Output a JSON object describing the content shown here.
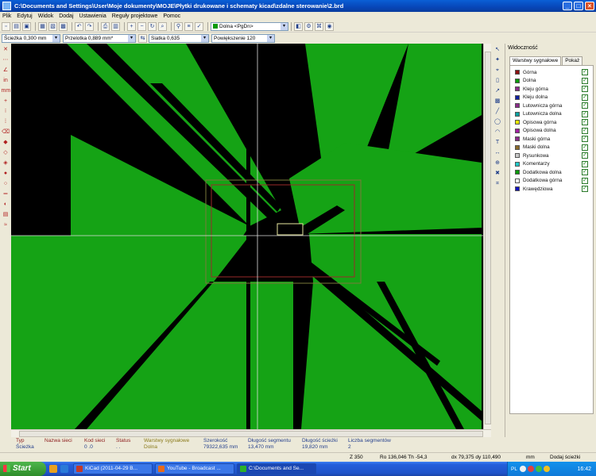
{
  "window": {
    "title": "C:\\Documents and Settings\\User\\Moje dokumenty\\MOJE\\Płytki drukowane i schematy kicad\\zdalne sterowanie\\2.brd",
    "minimize": "_",
    "maximize": "□",
    "close": "×"
  },
  "menu": [
    "Plik",
    "Edytuj",
    "Widok",
    "Dodaj",
    "Ustawienia",
    "Reguły projektowe",
    "Pomoc"
  ],
  "toolbar": {
    "active_layer": "Dolna <PgDn>"
  },
  "toolbar2": {
    "track": "Ścieżka 0,300 mm",
    "via": "Przelotka 0,889 mm*",
    "grid": "Siatka 0,635",
    "zoom": "Powiększenie 120"
  },
  "panel": {
    "title": "Widoczność",
    "tabs": [
      "Warstwy sygnałowe",
      "Pokaż"
    ],
    "layers": [
      {
        "name": "Górna",
        "color": "#8b1010"
      },
      {
        "name": "Dolna",
        "color": "#0a9a0a"
      },
      {
        "name": "Kleju górna",
        "color": "#8a2a8a"
      },
      {
        "name": "Kleju dolna",
        "color": "#1020a0"
      },
      {
        "name": "Lutownicza górna",
        "color": "#8a2a8a"
      },
      {
        "name": "Lutownicza dolna",
        "color": "#0aa0a0"
      },
      {
        "name": "Opisowa górna",
        "color": "#e8e800"
      },
      {
        "name": "Opisowa dolna",
        "color": "#a020a0"
      },
      {
        "name": "Maski górna",
        "color": "#8a2a8a"
      },
      {
        "name": "Maski dolna",
        "color": "#8a6a2a"
      },
      {
        "name": "Rysunkowa",
        "color": "#c8c8c8"
      },
      {
        "name": "Komentarzy",
        "color": "#20c8c8"
      },
      {
        "name": "Dodatkowa dolna",
        "color": "#0a9a0a"
      },
      {
        "name": "Dodatkowa górna",
        "color": "#ffffff"
      },
      {
        "name": "Krawędziowa",
        "color": "#1010c0"
      }
    ]
  },
  "status": {
    "col1": {
      "label": "Typ",
      "value": "Ścieżka"
    },
    "col2": {
      "label": "Nazwa sieci",
      "value": ""
    },
    "col3": {
      "label": "Kod sieci",
      "value": "0 .0"
    },
    "col4": {
      "label": "Status",
      "value": ". ."
    },
    "col5": {
      "label": "Warstwy sygnałowe",
      "value": "Dolna"
    },
    "col6": {
      "label": "Szerokość",
      "value": "79322,635 mm"
    },
    "col7": {
      "label": "Długość segmentu",
      "value": "13,470 mm"
    },
    "col8": {
      "label": "Długość ścieżki",
      "value": "19,820 mm"
    },
    "col9": {
      "label": "Liczba segmentów",
      "value": "2"
    }
  },
  "statusbar": {
    "zoom": "Z 350",
    "coords": "Ro 136,046 Th -54,3",
    "delta": "dx 79,375  dy 110,490",
    "units": "mm",
    "mode": "Dodaj ścieżki"
  },
  "taskbar": {
    "start": "Start",
    "tasks": [
      {
        "label": "KiCad (2011-04-29 B...",
        "color": "#c23a2a"
      },
      {
        "label": "YouTube - Broadcast ...",
        "color": "#e86a1a"
      },
      {
        "label": "C:\\Documents and Se...",
        "color": "#2ab02a"
      }
    ],
    "lang": "PL",
    "clock": "16:42"
  }
}
